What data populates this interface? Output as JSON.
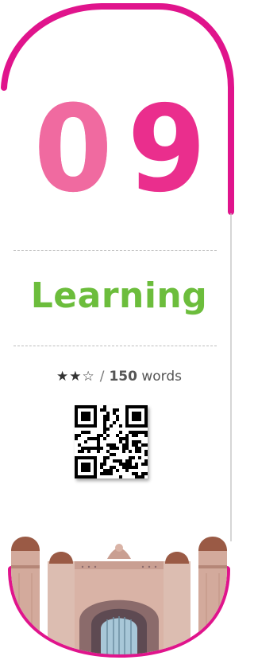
{
  "chapter": {
    "number_first_digit": "0",
    "number_second_digit": "9"
  },
  "title": "Learning",
  "meta": {
    "stars": "★★☆",
    "separator": "/",
    "word_count": "150",
    "word_unit": "words"
  },
  "icons": {
    "qr": "qr-code-icon",
    "building": "building-illustration"
  },
  "colors": {
    "frame_pink": "#e0148c",
    "digit_light_pink": "#f06aa0",
    "digit_pink": "#ea2e8d",
    "title_green": "#6cbd3c"
  }
}
